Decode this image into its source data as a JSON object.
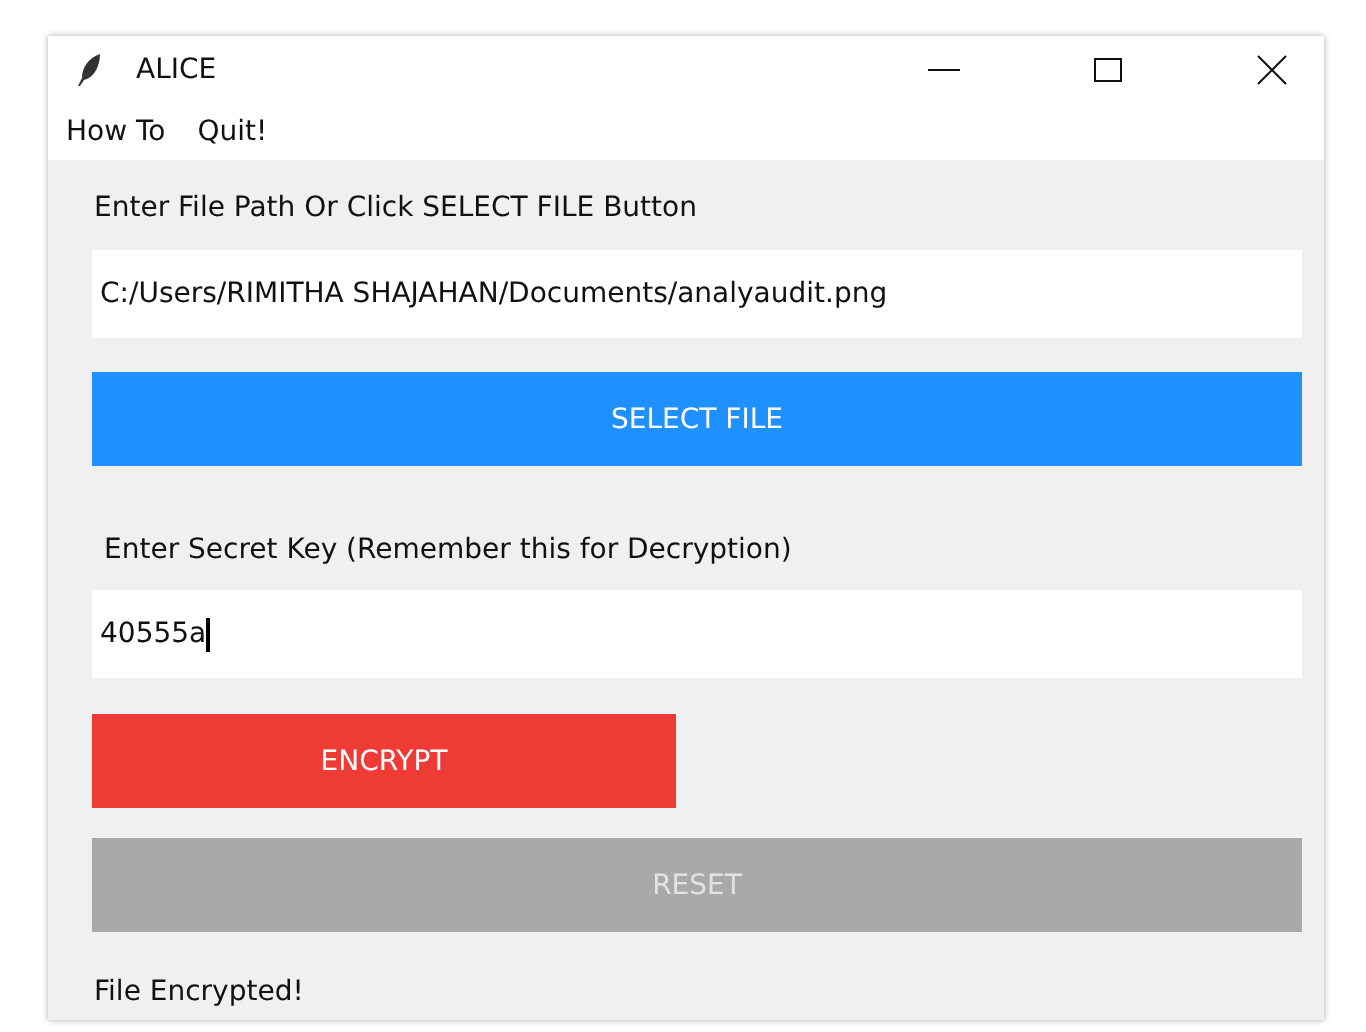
{
  "window": {
    "title": "ALICE"
  },
  "menu": [
    "How To",
    "Quit!"
  ],
  "path_label": "Enter File Path Or Click SELECT FILE Button",
  "path_field": {
    "value": "C:/Users/RIMITHA SHAJAHAN/Documents/analyaudit.png"
  },
  "select_button": "SELECT FILE",
  "key_label": "Enter Secret Key (Remember this for Decryption)",
  "key_field": {
    "value": "40555a",
    "focused": true
  },
  "encrypt_button": "ENCRYPT",
  "reset_button": {
    "label": "RESET",
    "disabled": true
  },
  "status": "File Encrypted!"
}
